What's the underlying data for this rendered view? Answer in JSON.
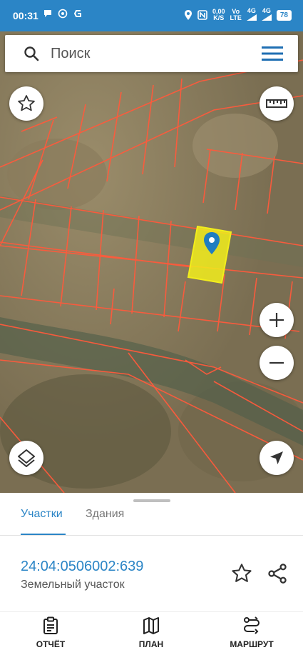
{
  "status_bar": {
    "time": "00:31",
    "speed_value": "0,00",
    "speed_unit": "K/S",
    "vo": "Vo",
    "lte": "LTE",
    "net1": "4G",
    "net2": "4G",
    "battery": "78"
  },
  "search": {
    "placeholder": "Поиск"
  },
  "map": {
    "parcel_highlight_color": "#f2ed1c",
    "boundary_color": "#ff5a3c"
  },
  "tabs": [
    {
      "label": "Участки",
      "active": true
    },
    {
      "label": "Здания",
      "active": false
    }
  ],
  "parcel": {
    "number": "24:04:0506002:639",
    "type": "Земельный участок"
  },
  "bottom_nav": [
    {
      "label": "ОТЧЁТ",
      "icon": "clipboard-icon"
    },
    {
      "label": "ПЛАН",
      "icon": "map-icon"
    },
    {
      "label": "МАРШРУТ",
      "icon": "route-icon"
    }
  ],
  "colors": {
    "accent": "#2b85c6"
  }
}
